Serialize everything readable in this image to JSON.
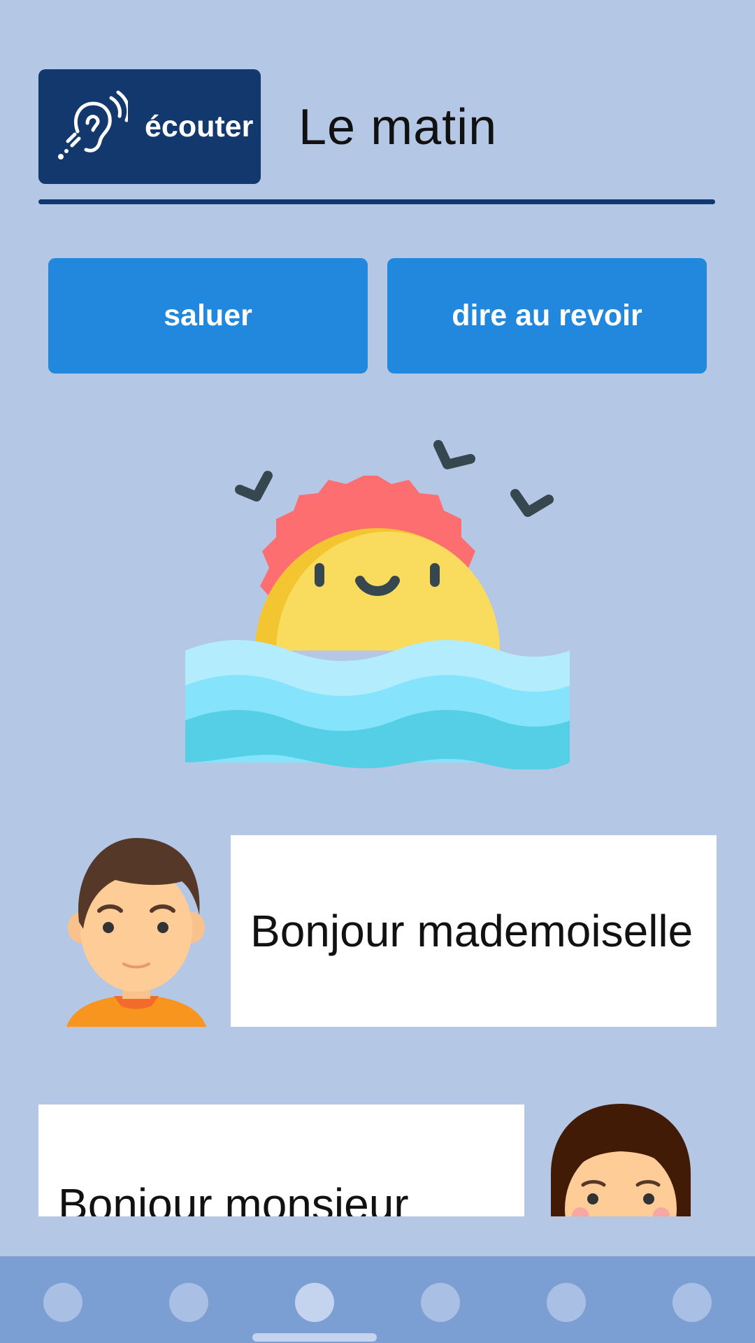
{
  "header": {
    "listen_label": "écouter",
    "title": "Le matin"
  },
  "actions": {
    "greet_label": "saluer",
    "goodbye_label": "dire au revoir"
  },
  "dialogue": [
    {
      "speaker": "boy",
      "text": "Bonjour mademoiselle"
    },
    {
      "speaker": "girl",
      "text": "Bonjour monsieur"
    }
  ],
  "icons": {
    "listen": "ear-hearing-icon",
    "scene": "sunrise-over-sea-illustration"
  },
  "bottom_nav": {
    "page_count": 6,
    "active_index": 2
  },
  "colors": {
    "background": "#b4c7e4",
    "header_dark": "#12386e",
    "button_blue": "#2288dd",
    "nav_bar": "#7b9fd3"
  }
}
